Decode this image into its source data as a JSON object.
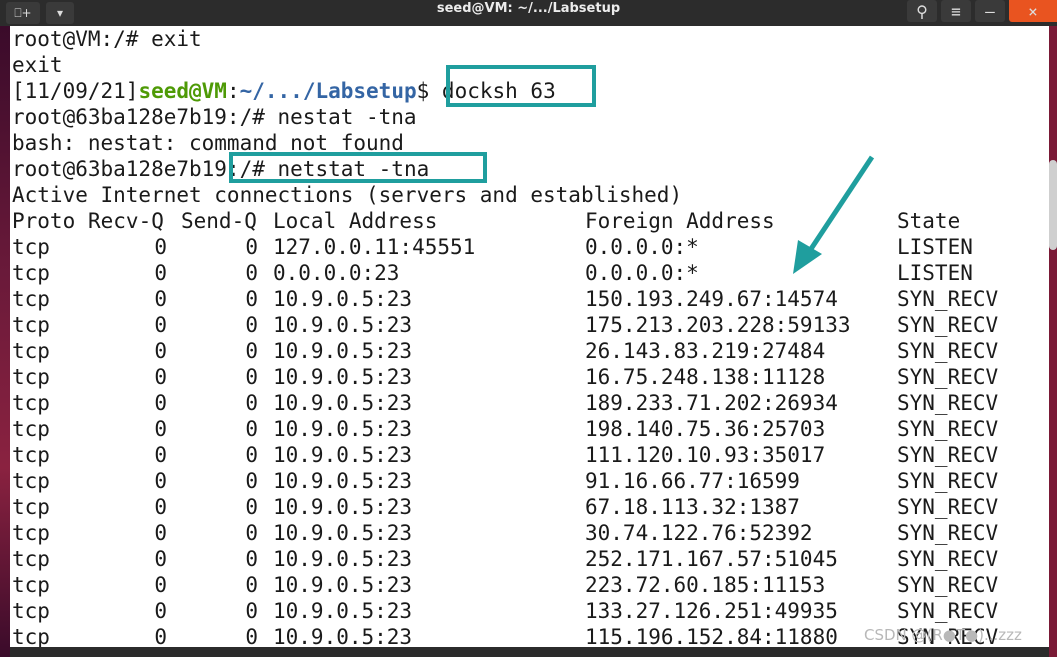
{
  "window": {
    "title": "seed@VM: ~/.../Labsetup",
    "newtab_icon": "⎕+",
    "menu_icon": "▾",
    "search_icon": "⚲",
    "hamburger_icon": "≡",
    "minimize_icon": "–",
    "close_icon": "×"
  },
  "colors": {
    "prompt_user": "#4e9a06",
    "prompt_path": "#3465a4",
    "highlight_box": "#1f9e9e",
    "arrow": "#1f9e9e"
  },
  "terminal": {
    "line1": "root@VM:/# exit",
    "line2": "exit",
    "prompt": {
      "date": "[11/09/21]",
      "user": "seed@VM",
      "colon": ":",
      "path": "~/.../Labsetup",
      "dollar": "$ ",
      "command": "docksh 63"
    },
    "line4": "root@63ba128e7b19:/# nestat -tna",
    "line5": "bash: nestat: command not found",
    "line6_prefix": "root@63ba128e7b19",
    "line6_cmd": ":/# netstat -tna",
    "line7": "Active Internet connections (servers and established)",
    "headers": [
      "Proto",
      "Recv-Q",
      "Send-Q",
      "Local Address",
      "Foreign Address",
      "State"
    ],
    "rows": [
      [
        "tcp",
        "0",
        "0",
        "127.0.0.11:45551",
        "0.0.0.0:*",
        "LISTEN"
      ],
      [
        "tcp",
        "0",
        "0",
        "0.0.0.0:23",
        "0.0.0.0:*",
        "LISTEN"
      ],
      [
        "tcp",
        "0",
        "0",
        "10.9.0.5:23",
        "150.193.249.67:14574",
        "SYN_RECV"
      ],
      [
        "tcp",
        "0",
        "0",
        "10.9.0.5:23",
        "175.213.203.228:59133",
        "SYN_RECV"
      ],
      [
        "tcp",
        "0",
        "0",
        "10.9.0.5:23",
        "26.143.83.219:27484",
        "SYN_RECV"
      ],
      [
        "tcp",
        "0",
        "0",
        "10.9.0.5:23",
        "16.75.248.138:11128",
        "SYN_RECV"
      ],
      [
        "tcp",
        "0",
        "0",
        "10.9.0.5:23",
        "189.233.71.202:26934",
        "SYN_RECV"
      ],
      [
        "tcp",
        "0",
        "0",
        "10.9.0.5:23",
        "198.140.75.36:25703",
        "SYN_RECV"
      ],
      [
        "tcp",
        "0",
        "0",
        "10.9.0.5:23",
        "111.120.10.93:35017",
        "SYN_RECV"
      ],
      [
        "tcp",
        "0",
        "0",
        "10.9.0.5:23",
        "91.16.66.77:16599",
        "SYN_RECV"
      ],
      [
        "tcp",
        "0",
        "0",
        "10.9.0.5:23",
        "67.18.113.32:1387",
        "SYN_RECV"
      ],
      [
        "tcp",
        "0",
        "0",
        "10.9.0.5:23",
        "30.74.122.76:52392",
        "SYN_RECV"
      ],
      [
        "tcp",
        "0",
        "0",
        "10.9.0.5:23",
        "252.171.167.57:51045",
        "SYN_RECV"
      ],
      [
        "tcp",
        "0",
        "0",
        "10.9.0.5:23",
        "223.72.60.185:11153",
        "SYN_RECV"
      ],
      [
        "tcp",
        "0",
        "0",
        "10.9.0.5:23",
        "133.27.126.251:49935",
        "SYN_RECV"
      ],
      [
        "tcp",
        "0",
        "0",
        "10.9.0.5:23",
        "115.196.152.84:11880",
        "SYN_RECV"
      ]
    ]
  },
  "watermark": "CSDN @(R●T●)...zzz"
}
